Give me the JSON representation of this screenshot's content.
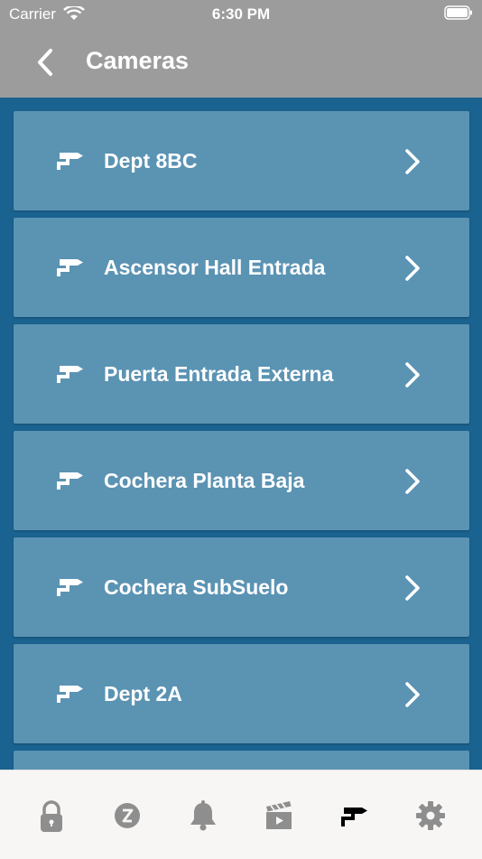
{
  "status_bar": {
    "carrier": "Carrier",
    "time": "6:30 PM"
  },
  "nav": {
    "title": "Cameras",
    "back_icon": "chevron-left-icon"
  },
  "cameras": [
    {
      "label": "Dept 8BC",
      "icon": "security-camera-icon"
    },
    {
      "label": "Ascensor Hall Entrada",
      "icon": "security-camera-icon"
    },
    {
      "label": "Puerta Entrada Externa",
      "icon": "security-camera-icon"
    },
    {
      "label": "Cochera Planta Baja",
      "icon": "security-camera-icon"
    },
    {
      "label": "Cochera SubSuelo",
      "icon": "security-camera-icon"
    },
    {
      "label": "Dept 2A",
      "icon": "security-camera-icon"
    }
  ],
  "tabs": [
    {
      "icon": "lock-icon",
      "active": false
    },
    {
      "icon": "zone-icon",
      "active": false
    },
    {
      "icon": "bell-icon",
      "active": false
    },
    {
      "icon": "clapperboard-icon",
      "active": false
    },
    {
      "icon": "security-camera-icon",
      "active": true
    },
    {
      "icon": "gear-icon",
      "active": false
    }
  ],
  "colors": {
    "header": "#9c9c9c",
    "background": "#1a6390",
    "card": "#5b93b3",
    "tabbar": "#f7f6f4",
    "tab_inactive": "#8e8e8e",
    "tab_active": "#000000"
  }
}
